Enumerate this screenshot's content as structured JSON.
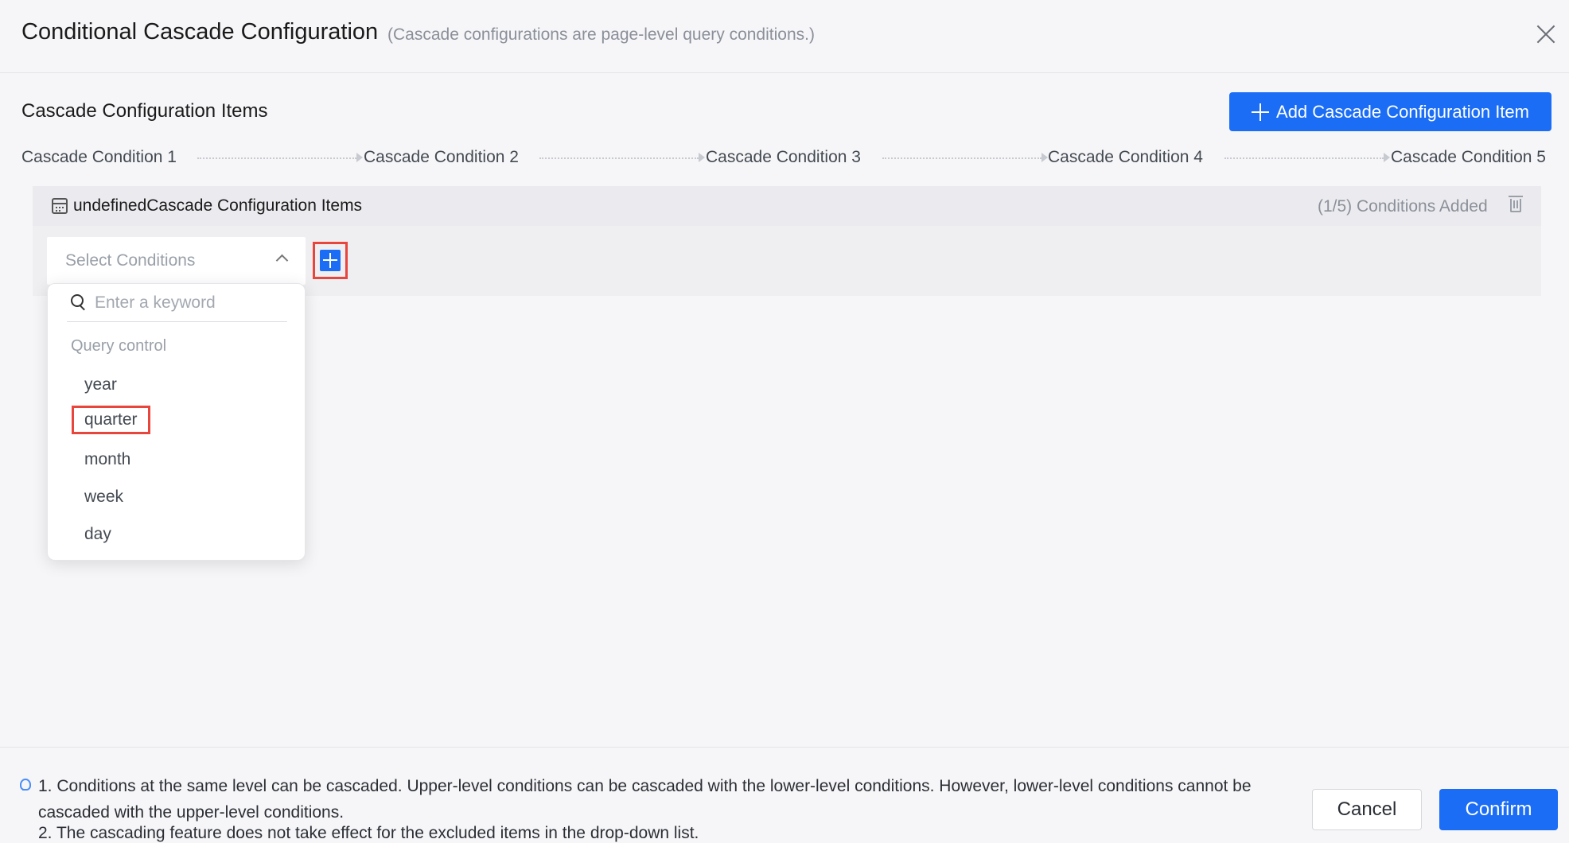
{
  "dialog": {
    "title": "Conditional Cascade Configuration",
    "subtitle": "(Cascade configurations are page-level query conditions.)",
    "close_icon": "close-icon"
  },
  "section": {
    "title": "Cascade Configuration Items",
    "add_button_label": "Add Cascade Configuration Item"
  },
  "steps": [
    "Cascade Condition 1",
    "Cascade Condition 2",
    "Cascade Condition 3",
    "Cascade Condition 4",
    "Cascade Condition 5"
  ],
  "panel": {
    "title": "undefinedCascade Configuration Items",
    "count_text": "(1/5) Conditions Added"
  },
  "select": {
    "placeholder": "Select Conditions",
    "search_placeholder": "Enter a keyword",
    "group_label": "Query control",
    "options": [
      "year",
      "quarter",
      "month",
      "week",
      "day"
    ],
    "highlighted_option": "quarter"
  },
  "notes": {
    "line1": "1. Conditions at the same level can be cascaded. Upper-level conditions can be cascaded with the lower-level conditions. However, lower-level conditions cannot be cascaded with the upper-level conditions.",
    "line2": "2. The cascading feature does not take effect for the excluded items in the drop-down list."
  },
  "footer": {
    "cancel_label": "Cancel",
    "confirm_label": "Confirm"
  },
  "colors": {
    "primary": "#1b6df5",
    "highlight": "#e8453c",
    "background": "#f6f6f8"
  }
}
